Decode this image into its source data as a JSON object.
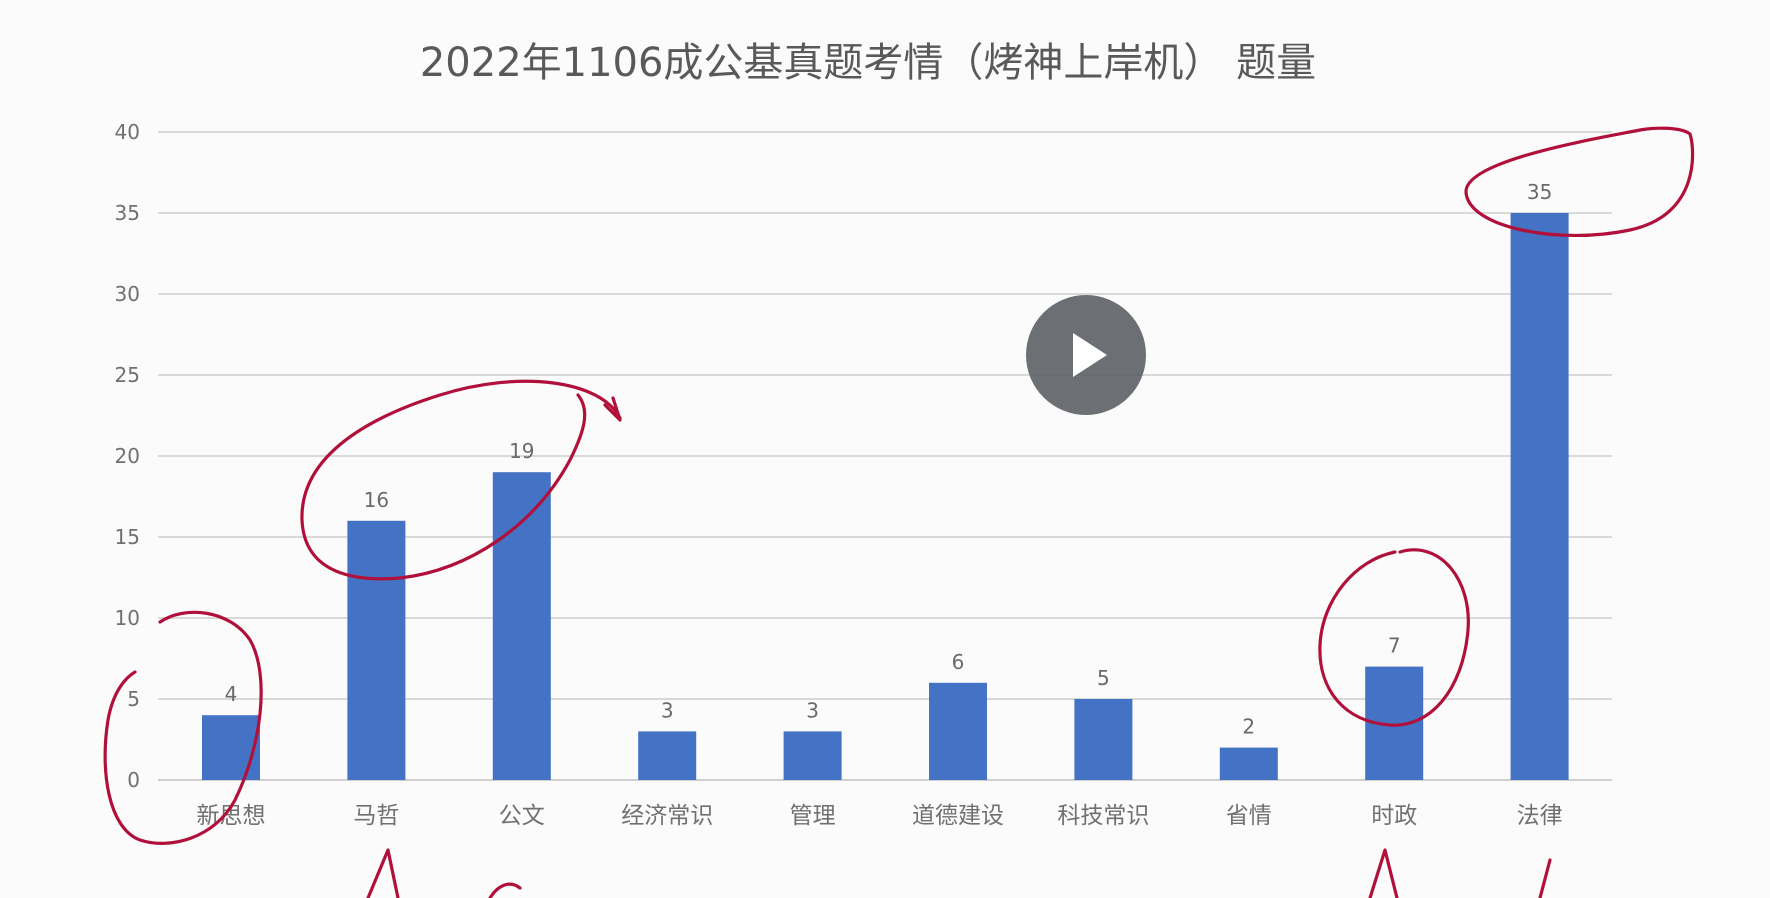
{
  "colors": {
    "bar": "#4472c4",
    "background": "#fbfbfb",
    "annotation_ink": "#b0103a",
    "play_button": "#5f6368"
  },
  "player": {
    "play_icon": "play-icon"
  },
  "chart_data": {
    "type": "bar",
    "title": "2022年1106成公基真题考情（烤神上岸机） 题量",
    "xlabel": "",
    "ylabel": "",
    "ylim": [
      0,
      40
    ],
    "yticks": [
      0,
      5,
      10,
      15,
      20,
      25,
      30,
      35,
      40
    ],
    "grid": true,
    "categories": [
      "新思想",
      "马哲",
      "公文",
      "经济常识",
      "管理",
      "道德建设",
      "科技常识",
      "省情",
      "时政",
      "法律"
    ],
    "values": [
      4,
      16,
      19,
      3,
      3,
      6,
      5,
      2,
      7,
      35
    ]
  }
}
